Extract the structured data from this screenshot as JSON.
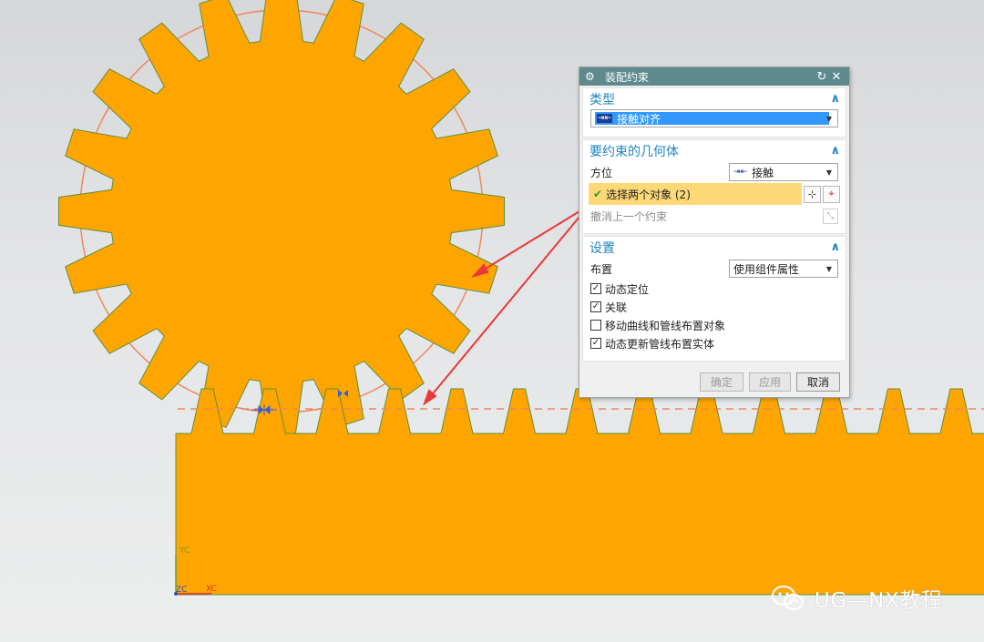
{
  "dialog": {
    "title": "装配约束",
    "icons": {
      "title": "gear-icon",
      "reset": "reset-icon",
      "close": "close-icon"
    },
    "groups": {
      "type": {
        "title": "类型",
        "selected": "接触对齐",
        "selected_icon": "touch-align-icon"
      },
      "geometry": {
        "title": "要约束的几何体",
        "orientation_label": "方位",
        "orientation_value": "接触",
        "orientation_icon": "touch-icon",
        "select_label": "选择两个对象 (2)",
        "select_icon": "check-icon",
        "undo_label": "撤消上一个约束"
      },
      "settings": {
        "title": "设置",
        "layout_label": "布置",
        "layout_value": "使用组件属性",
        "options": [
          {
            "label": "动态定位",
            "checked": true
          },
          {
            "label": "关联",
            "checked": true
          },
          {
            "label": "移动曲线和管线布置对象",
            "checked": false
          },
          {
            "label": "动态更新管线布置实体",
            "checked": true
          }
        ]
      }
    },
    "buttons": {
      "ok": "确定",
      "apply": "应用",
      "cancel": "取消"
    }
  },
  "viewport": {
    "colors": {
      "gear": "#ffa500",
      "outline": "#5f8f3a",
      "pitch_circle": "#f0875a",
      "arrow": "#e8383a",
      "background": "#dcdddf"
    },
    "axis": {
      "y": "YC",
      "x": "XC",
      "z": "ZC"
    }
  },
  "watermark": {
    "text": "UG—NX教程"
  }
}
